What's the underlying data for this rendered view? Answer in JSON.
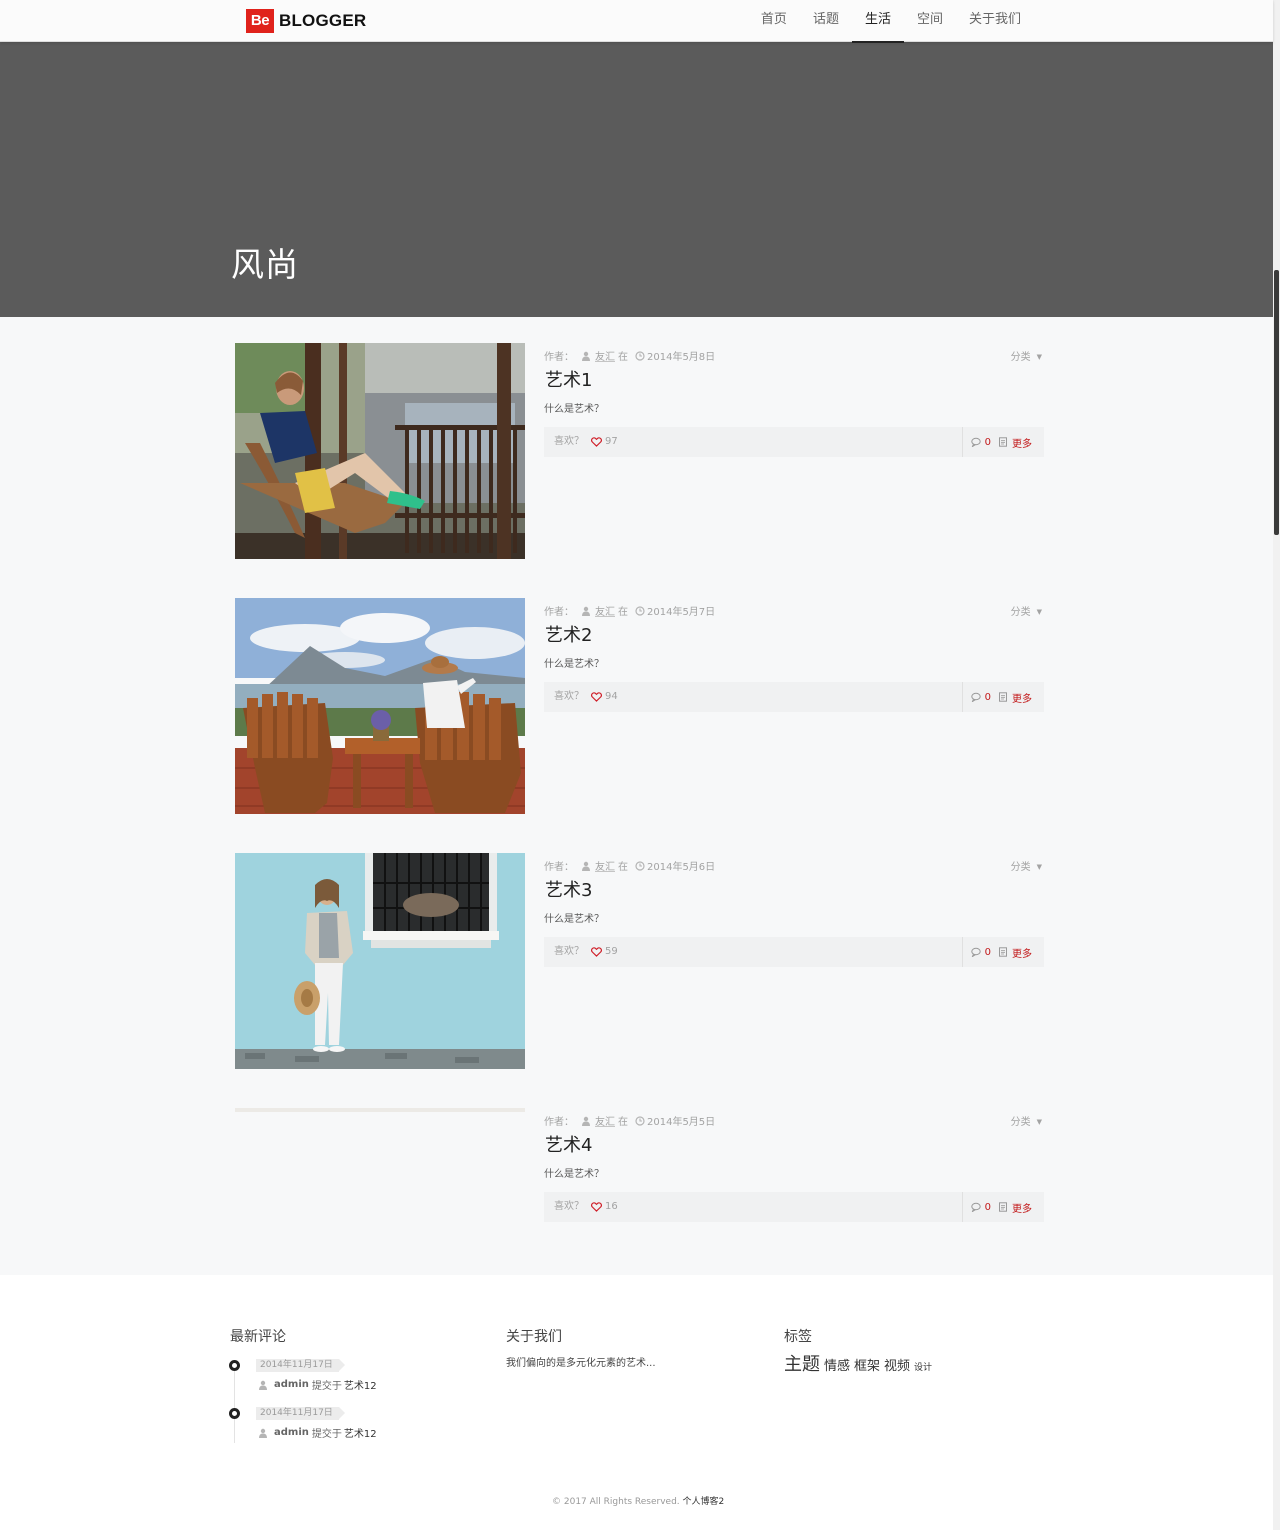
{
  "brand": {
    "mark": "Be",
    "name": "BLOGGER"
  },
  "nav": {
    "items": [
      {
        "label": "首页"
      },
      {
        "label": "话题"
      },
      {
        "label": "生活"
      },
      {
        "label": "空间"
      },
      {
        "label": "关于我们"
      }
    ],
    "active": "生活"
  },
  "hero": {
    "title": "风尚"
  },
  "post_labels": {
    "author_prefix": "作者：",
    "at": "在",
    "category": "分类",
    "like": "喜欢？",
    "more": "更多"
  },
  "posts": [
    {
      "author": "友汇",
      "date": "2014年5月8日",
      "title": "艺术1",
      "excerpt": "什么是艺术？",
      "likes": "97",
      "comments": "0",
      "image": "woman on porch swing chair"
    },
    {
      "author": "友汇",
      "date": "2014年5月7日",
      "title": "艺术2",
      "excerpt": "什么是艺术？",
      "likes": "94",
      "comments": "0",
      "image": "two wooden chairs overlooking lake and mountains"
    },
    {
      "author": "友汇",
      "date": "2014年5月6日",
      "title": "艺术3",
      "excerpt": "什么是艺术？",
      "likes": "59",
      "comments": "0",
      "image": "woman standing against light blue wall"
    },
    {
      "author": "友汇",
      "date": "2014年5月5日",
      "title": "艺术4",
      "excerpt": "什么是艺术？",
      "likes": "16",
      "comments": "0",
      "image": ""
    }
  ],
  "footer": {
    "recent_comments": {
      "title": "最新评论",
      "items": [
        {
          "date": "2014年11月17日",
          "user": "admin",
          "action": "提交于",
          "post": "艺术12"
        },
        {
          "date": "2014年11月17日",
          "user": "admin",
          "action": "提交于",
          "post": "艺术12"
        }
      ]
    },
    "about": {
      "title": "关于我们",
      "text": "我们偏向的是多元化元素的艺术..."
    },
    "tags": {
      "title": "标签",
      "items": [
        "主题",
        "情感",
        "框架",
        "视频",
        "设计"
      ]
    }
  },
  "copyright": {
    "text": "© 2017 All Rights Reserved.",
    "site": "个人博客2"
  },
  "colors": {
    "accent": "#c2191a",
    "brand_red": "#e0221b",
    "hero_bg": "#5b5b5b"
  }
}
